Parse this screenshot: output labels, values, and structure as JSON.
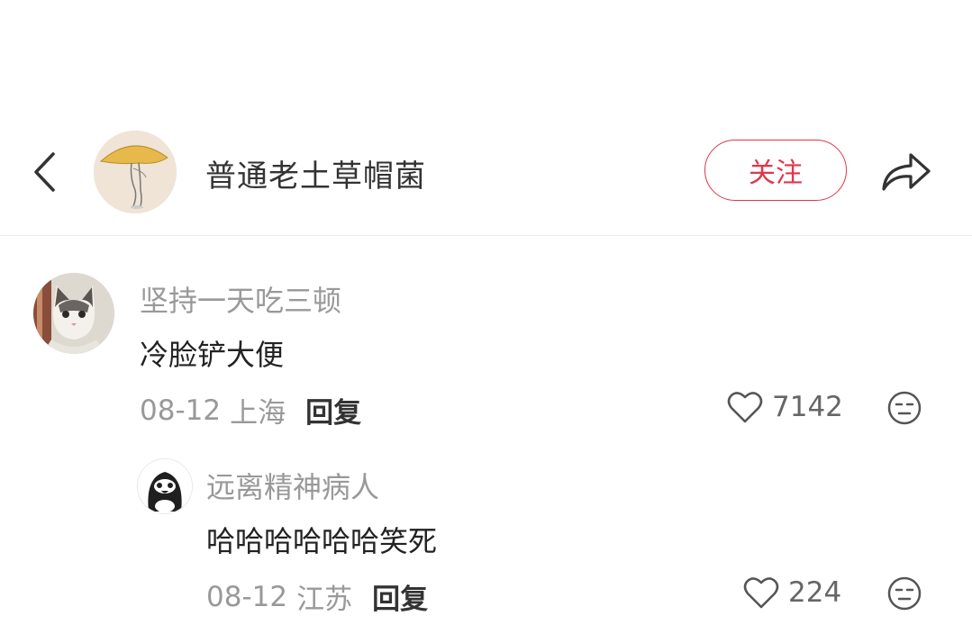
{
  "header": {
    "back_icon": "chevron-left-icon",
    "author_name": "普通老土草帽菌",
    "follow_label": "关注",
    "share_icon": "share-arrow-icon",
    "accent_color": "#e0364a"
  },
  "comments": [
    {
      "username": "坚持一天吃三顿",
      "text": "冷脸铲大便",
      "date": "08-12",
      "location": "上海",
      "reply_label": "回复",
      "likes": "7142",
      "avatar": "cat-avatar"
    }
  ],
  "replies": [
    {
      "username": "远离精神病人",
      "text": "哈哈哈哈哈哈笑死",
      "date": "08-12",
      "location": "江苏",
      "reply_label": "回复",
      "likes": "224",
      "avatar": "penguin-avatar"
    }
  ]
}
